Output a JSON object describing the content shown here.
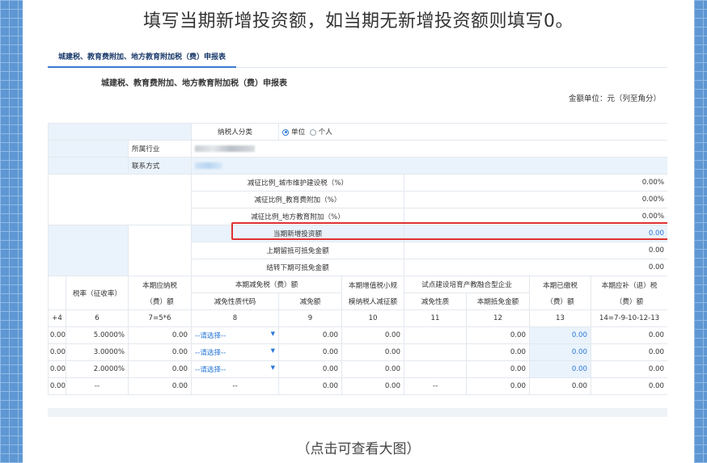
{
  "headline": "填写当期新增投资额，如当期无新增投资额则填写0。",
  "caption": "（点击可查看大图）",
  "tab_label": "城建税、教育费附加、地方教育附加税（费）申报表",
  "form_title": "城建税、教育费附加、地方教育附加税（费）申报表",
  "unit_text": "金额单位：元（列至角分）",
  "taxpayer": {
    "label": "纳税人分类",
    "option_unit": "单位",
    "option_person": "个人"
  },
  "industry_label": "所属行业",
  "contact_label": "联系方式",
  "reduce_rows": [
    {
      "label": "减征比例_城市维护建设税（%）",
      "value": "0.00%"
    },
    {
      "label": "减征比例_教育费附加（%）",
      "value": "0.00%"
    },
    {
      "label": "减征比例_地方教育附加（%）",
      "value": "0.00%"
    }
  ],
  "investment": {
    "label": "当期新增投资额",
    "value": "0.00"
  },
  "prev_credit": {
    "label": "上期留抵可抵免金额",
    "value": "0.00"
  },
  "carry_credit": {
    "label": "结转下期可抵免金额",
    "value": "0.00"
  },
  "headers": {
    "rate": "税率（征收率）",
    "payable_1": "本期应纳税",
    "payable_2": "（费）额",
    "reduction": "本期减免税（费）额",
    "reduction_code": "减免性质代码",
    "reduction_amount": "减免额",
    "vat_small_1": "本期增值税小规",
    "vat_small_2": "模纳税人减征额",
    "pilot": "试点建设培育产教融合型企业",
    "pilot_nature": "减免性质",
    "pilot_credit": "本期抵免金额",
    "paid_1": "本期已缴税",
    "paid_2": "（费）额",
    "refund_1": "本期应补（退）税",
    "refund_2": "（费）额"
  },
  "col_numbers": [
    "+4",
    "6",
    "7=5*6",
    "8",
    "9",
    "10",
    "11",
    "12",
    "13",
    "14=7-9-10-12-13"
  ],
  "select_placeholder": "--请选择--",
  "data_rows": [
    {
      "c0": "0.00",
      "rate": "5.0000%",
      "payable": "0.00",
      "code": "--请选择--",
      "amount": "0.00",
      "vat": "0.00",
      "nature": "",
      "credit": "0.00",
      "paid": "0.00",
      "refund": "0.00"
    },
    {
      "c0": "0.00",
      "rate": "3.0000%",
      "payable": "0.00",
      "code": "--请选择--",
      "amount": "0.00",
      "vat": "0.00",
      "nature": "",
      "credit": "0.00",
      "paid": "0.00",
      "refund": "0.00"
    },
    {
      "c0": "0.00",
      "rate": "2.0000%",
      "payable": "0.00",
      "code": "--请选择--",
      "amount": "0.00",
      "vat": "0.00",
      "nature": "",
      "credit": "0.00",
      "paid": "0.00",
      "refund": "0.00"
    },
    {
      "c0": "0.00",
      "rate": "--",
      "payable": "0.00",
      "code": "--",
      "amount": "0.00",
      "vat": "0.00",
      "nature": "--",
      "credit": "0.00",
      "paid": "0.00",
      "refund": "0.00"
    }
  ],
  "colors": {
    "highlight": "#e03030",
    "accent": "#2a78d6",
    "page_bg": "#6a9fd6"
  }
}
